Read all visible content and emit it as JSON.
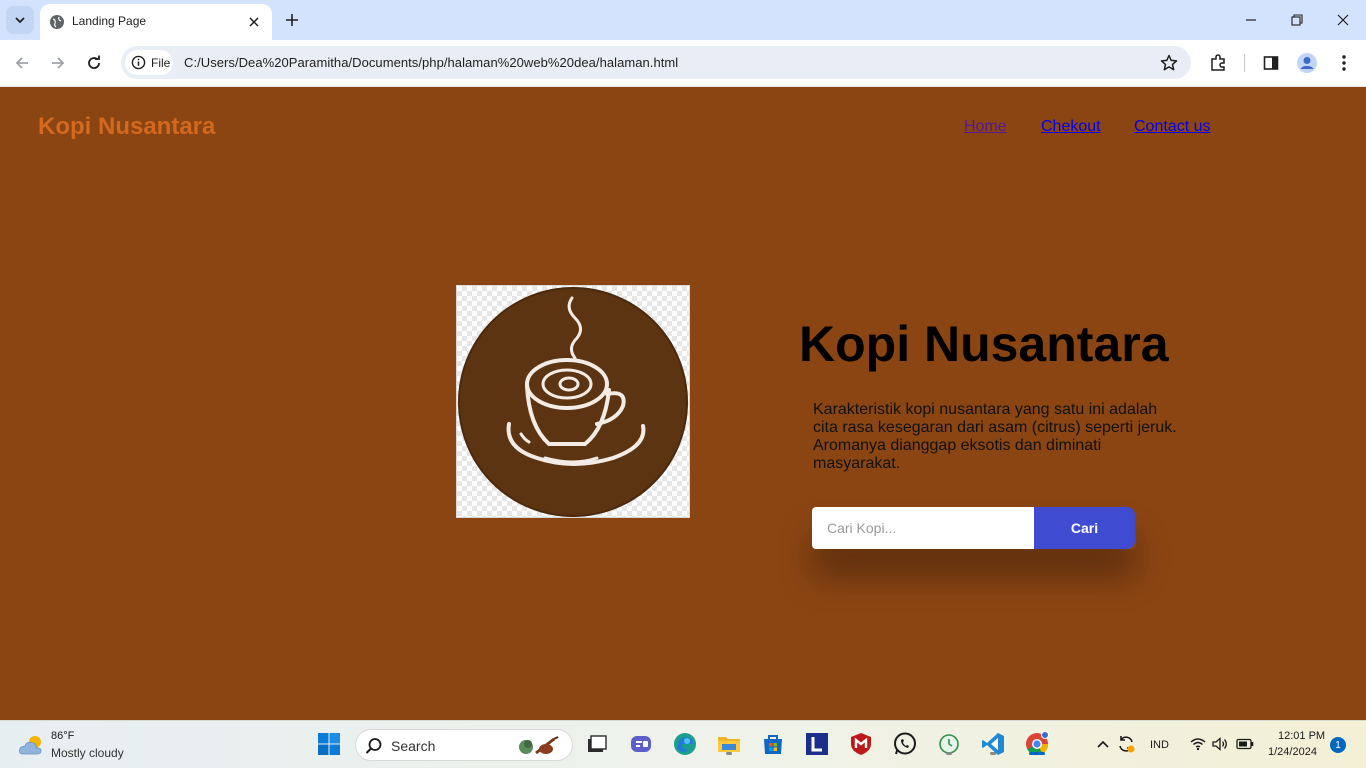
{
  "browser": {
    "tab_title": "Landing Page",
    "site_chip_label": "File",
    "url": "C:/Users/Dea%20Paramitha/Documents/php/halaman%20web%20dea/halaman.html",
    "icons": [
      "tab-search-icon",
      "globe-icon",
      "close-icon",
      "plus-icon",
      "minimize-icon",
      "restore-icon",
      "close-window-icon",
      "back-icon",
      "forward-icon",
      "reload-icon",
      "info-icon",
      "star-icon",
      "extensions-icon",
      "sidepanel-icon",
      "profile-icon",
      "kebab-menu-icon"
    ]
  },
  "page": {
    "brand": "Kopi Nusantara",
    "nav": {
      "home": "Home",
      "checkout": "Chekout",
      "contact": "Contact us"
    },
    "hero": {
      "title": "Kopi Nusantara",
      "description": "Karakteristik kopi nusantara yang satu ini adalah cita rasa kesegaran dari asam (citrus) seperti jeruk. Aromanya dianggap eksotis dan diminati masyarakat."
    },
    "search": {
      "placeholder": "Cari Kopi...",
      "button": "Cari"
    },
    "colors": {
      "background": "#8b4513",
      "brand": "#d2691e",
      "button": "#3f4bd1",
      "logo_circle": "#5c3412"
    }
  },
  "taskbar": {
    "weather_temp": "86°F",
    "weather_desc": "Mostly cloudy",
    "search_label": "Search",
    "language": "IND",
    "time": "12:01 PM",
    "date": "1/24/2024",
    "notification_count": "1"
  }
}
